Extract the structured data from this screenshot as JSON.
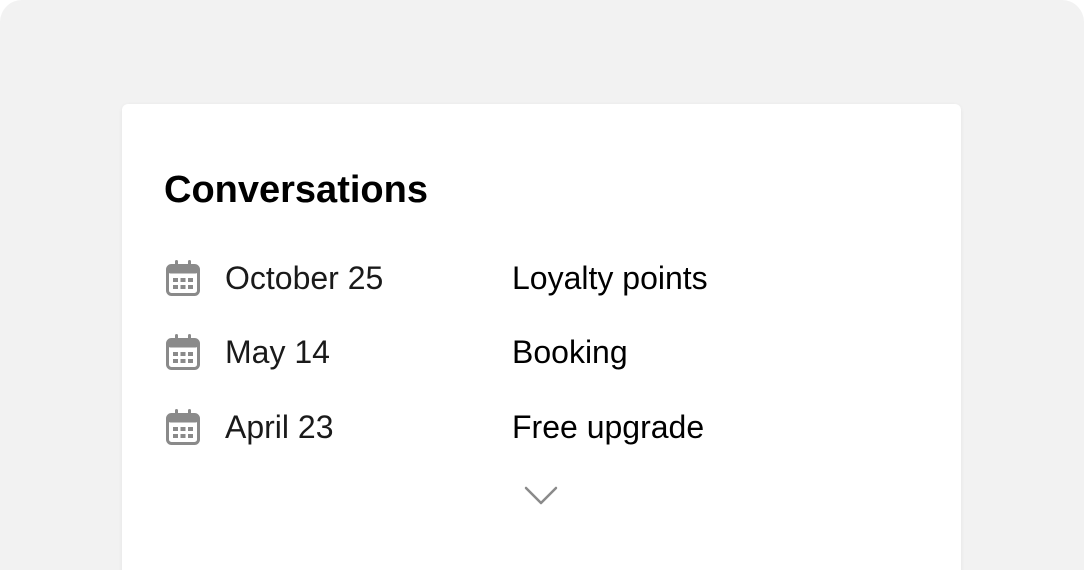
{
  "card": {
    "title": "Conversations"
  },
  "conversations": [
    {
      "date": "October 25",
      "topic": "Loyalty points",
      "icon": "calendar-icon"
    },
    {
      "date": "May 14",
      "topic": "Booking",
      "icon": "calendar-icon"
    },
    {
      "date": "April 23",
      "topic": "Free upgrade",
      "icon": "calendar-icon"
    }
  ],
  "expand": {
    "icon": "chevron-down-icon"
  },
  "colors": {
    "background": "#f2f2f2",
    "card": "#ffffff",
    "icon": "#8a8a8a",
    "text": "#000000"
  }
}
